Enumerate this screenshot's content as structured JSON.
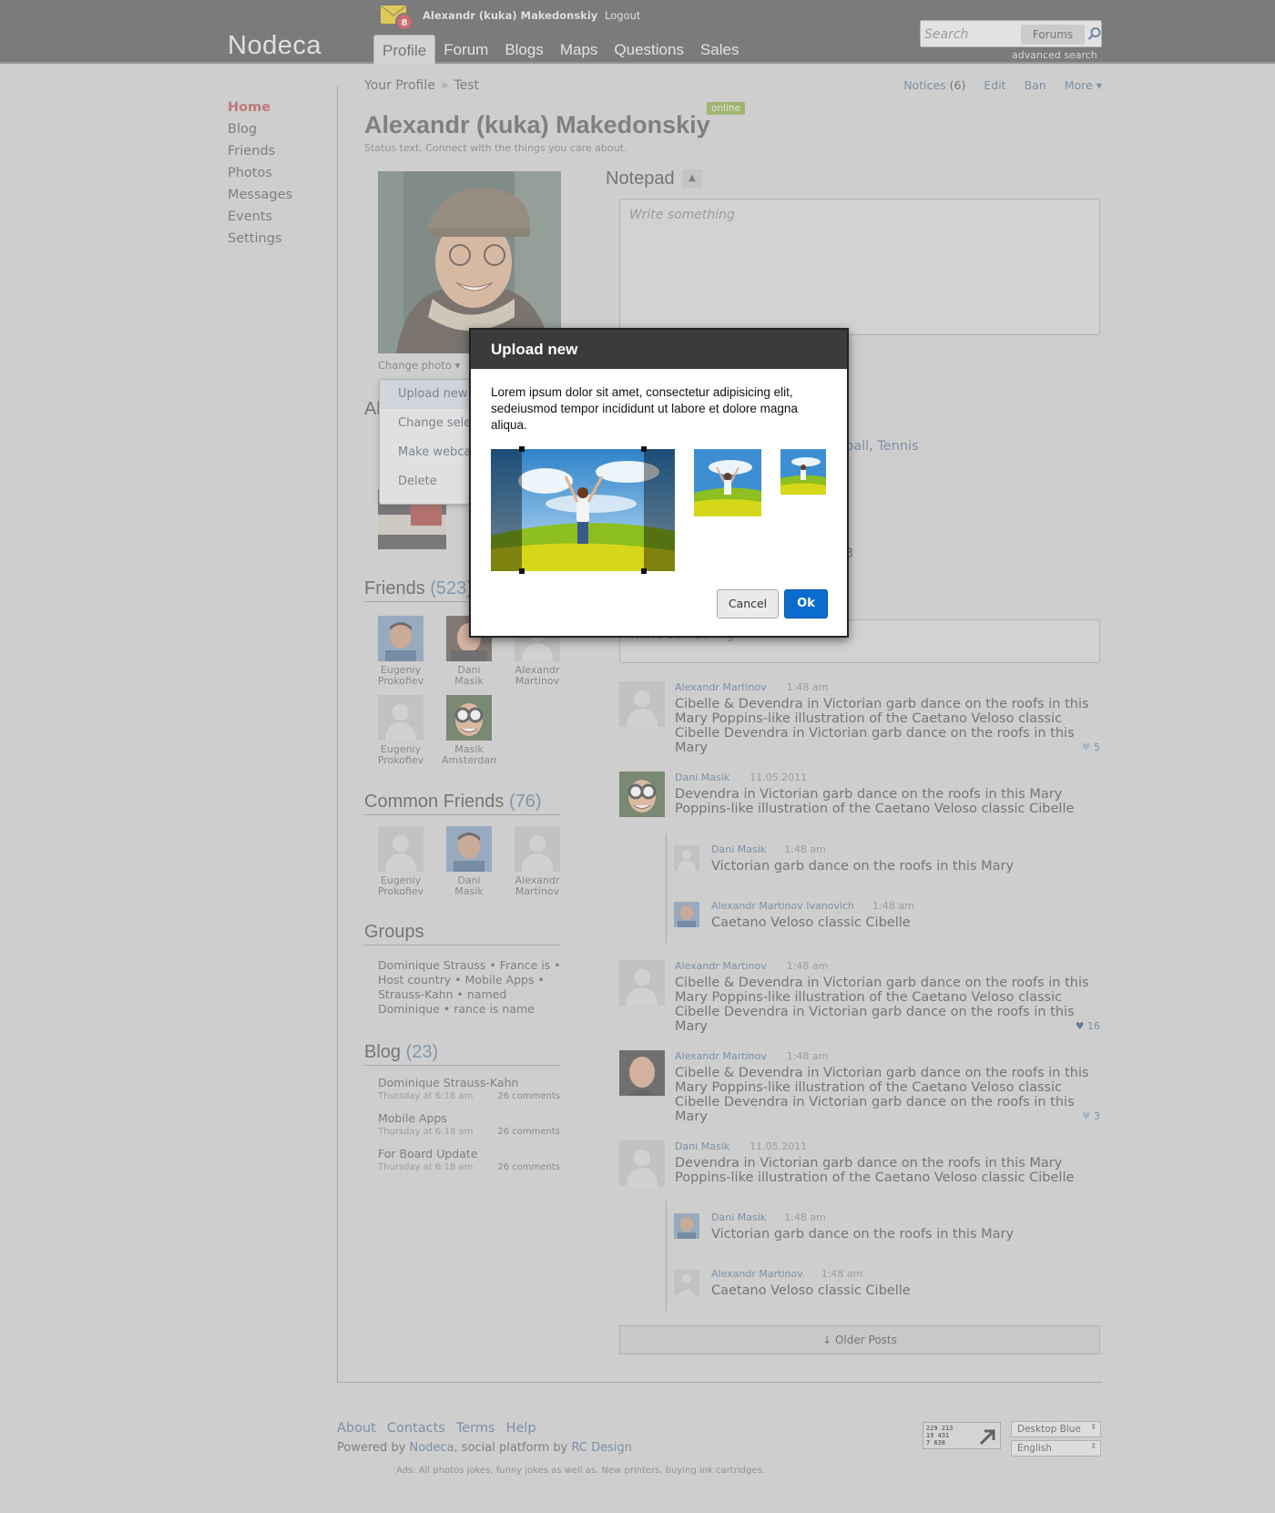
{
  "header": {
    "logo": "Nodeca",
    "mail_count": "8",
    "user_name": "Alexandr (kuka) Makedonskiy",
    "logout": "Logout",
    "tabs": [
      {
        "label": "Profile",
        "active": true
      },
      {
        "label": "Forum"
      },
      {
        "label": "Blogs"
      },
      {
        "label": "Maps"
      },
      {
        "label": "Questions"
      },
      {
        "label": "Sales"
      }
    ],
    "search": {
      "placeholder": "Search",
      "scope": "Forums",
      "advanced": "advanced search"
    }
  },
  "sidebar": {
    "items": [
      {
        "label": "Home",
        "active": true
      },
      {
        "label": "Blog"
      },
      {
        "label": "Friends"
      },
      {
        "label": "Photos"
      },
      {
        "label": "Messages"
      },
      {
        "label": "Events"
      },
      {
        "label": "Settings"
      }
    ]
  },
  "breadcrumb": {
    "items": [
      "Your Profile",
      "Test"
    ],
    "separator": "»"
  },
  "profile_actions": {
    "notices": "Notices",
    "notices_count": "(6)",
    "edit": "Edit",
    "ban": "Ban",
    "more": "More ▾"
  },
  "profile": {
    "name": "Alexandr (kuka) Makedonskiy",
    "online": "online",
    "status": "Status text. Connect with the things you care about.",
    "change_photo": "Change photo ▾",
    "section_partial": "Al"
  },
  "photo_menu": {
    "items": [
      "Upload new",
      "Change sele",
      "Make webca",
      "Delete"
    ]
  },
  "notepad": {
    "title": "Notepad",
    "toggle": "▲",
    "placeholder": "Write something"
  },
  "fragments": {
    "interests": "ball",
    "interests_link": "Tennis",
    "number": "3",
    "post_placeholder": "Write something"
  },
  "friends": {
    "title": "Friends",
    "count": "(523)",
    "items": [
      {
        "name1": "Eugeniy",
        "name2": "Prokofiev"
      },
      {
        "name1": "Dani",
        "name2": "Masik"
      },
      {
        "name1": "Alexandr",
        "name2": "Martinov"
      },
      {
        "name1": "Eugeniy",
        "name2": "Prokofiev"
      },
      {
        "name1": "Masik",
        "name2": "Amsterdam"
      }
    ]
  },
  "common_friends": {
    "title": "Common Friends",
    "count": "(76)",
    "items": [
      {
        "name1": "Eugeniy",
        "name2": "Prokofiev"
      },
      {
        "name1": "Dani",
        "name2": "Masik"
      },
      {
        "name1": "Alexandr",
        "name2": "Martinov"
      }
    ]
  },
  "groups": {
    "title": "Groups",
    "lines": [
      "Dominique Strauss • France is  •",
      "Host country • Mobile Apps •",
      "Strauss-Kahn • named",
      "Dominique • rance is name"
    ]
  },
  "blog": {
    "title": "Blog",
    "count": "(23)",
    "items": [
      {
        "title": "Dominique Strauss-Kahn",
        "date": "Thursday at 6:18 am",
        "comments": "26 comments"
      },
      {
        "title": "Mobile Apps",
        "date": "Thursday at 6:18 am",
        "comments": "26 comments"
      },
      {
        "title": "For Board Update",
        "date": "Thursday at 6:18 am",
        "comments": "26 comments"
      }
    ]
  },
  "feed": {
    "posts": [
      {
        "author": "Alexandr Martinov",
        "time": "1:48 am",
        "text": "Cibelle & Devendra in Victorian garb dance on the roofs in this Mary Poppins-like illustration of the Caetano Veloso classic Cibelle Devendra in Victorian garb dance on the roofs in this Mary",
        "likes": "5"
      },
      {
        "author": "Dani Masik",
        "time": "11.05.2011",
        "text": "Devendra in Victorian garb dance on the roofs in this Mary Poppins-like illustration of the Caetano Veloso classic Cibelle"
      },
      {
        "author": "Alexandr Martinov",
        "time": "1:48 am",
        "text": "Cibelle & Devendra in Victorian garb dance on the roofs in this Mary Poppins-like illustration of the Caetano Veloso classic Cibelle Devendra in Victorian garb dance on the roofs in this Mary",
        "likes": "16"
      },
      {
        "author": "Alexandr Martinov",
        "time": "1:48 am",
        "text": "Cibelle & Devendra in Victorian garb dance on the roofs in this Mary Poppins-like illustration of the Caetano Veloso classic Cibelle Devendra in Victorian garb dance on the roofs in this Mary",
        "likes": "3"
      },
      {
        "author": "Dani Masik",
        "time": "11.05.2011",
        "text": "Devendra in Victorian garb dance on the roofs in this Mary Poppins-like illustration of the Caetano Veloso classic Cibelle"
      }
    ],
    "replies": [
      {
        "author": "Dani Masik",
        "time": "1:48 am",
        "text": "Victorian garb dance on the roofs in this Mary"
      },
      {
        "author": "Alexandr Martinov Ivanovich",
        "time": "1:48 am",
        "text": "Caetano Veloso classic Cibelle"
      },
      {
        "author": "Dani Masik",
        "time": "1:48 am",
        "text": "Victorian garb dance on the roofs in this Mary"
      },
      {
        "author": "Alexandr Martinov",
        "time": "1:48 am",
        "text": "Caetano Veloso classic Cibelle"
      }
    ],
    "older": "↓ Older Posts"
  },
  "footer": {
    "links": [
      "About",
      "Contacts",
      "Terms",
      "Help"
    ],
    "powered_prefix": "Powered by",
    "powered_link": "Nodeca",
    "powered_mid": ", social platform by",
    "powered_by2": "RC Design",
    "ads": "Ads: All photos jokes, funny jokes as well as. New printers, buying ink cartridges.",
    "counter": [
      "229 213",
      "19 431",
      "7 636"
    ],
    "theme": "Desktop Blue",
    "language": "English"
  },
  "modal": {
    "title": "Upload new",
    "body": "Lorem ipsum dolor sit amet, consectetur adipisicing elit, sedeiusmod tempor incididunt ut labore et dolore magna aliqua.",
    "cancel": "Cancel",
    "ok": "Ok"
  },
  "colors": {
    "accent": "#b23838",
    "link": "#3d5f86",
    "primary_button": "#0b6ccf",
    "header_bg": "#3d3d3d",
    "online": "#7ea12c"
  }
}
